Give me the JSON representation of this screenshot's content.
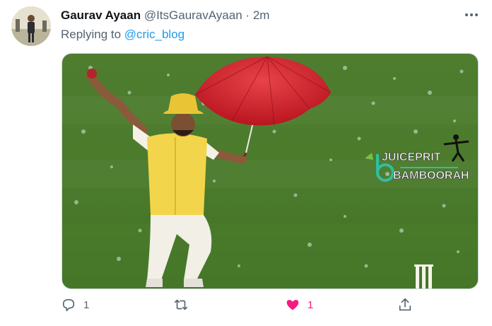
{
  "tweet": {
    "author_name": "Gaurav Ayaan",
    "handle": "@ItsGauravAyaan",
    "separator": "·",
    "time": "2m",
    "reply_prefix": "Replying to",
    "reply_to": "@cric_blog",
    "media": {
      "watermark_line1": "JUICEPRIT",
      "watermark_line2": "BAMBOORAH"
    },
    "actions": {
      "reply_count": "1",
      "retweet_count": "",
      "like_count": "1",
      "like_active": true
    }
  },
  "icons": {
    "more": "more-options-icon",
    "reply": "reply-icon",
    "retweet": "retweet-icon",
    "like": "heart-icon",
    "share": "share-icon"
  },
  "colors": {
    "accent": "#1d9bf0",
    "like": "#f91880",
    "secondary_text": "#536471"
  }
}
